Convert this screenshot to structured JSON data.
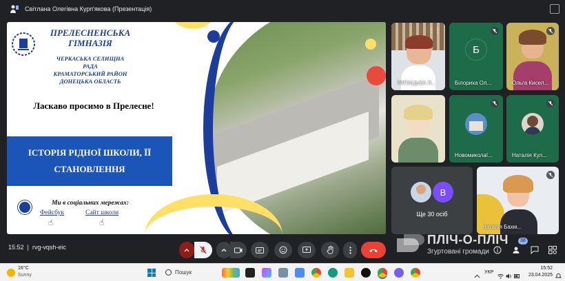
{
  "topbar": {
    "presenter_title": "Світлана Олегівна Курп'якова (Презентація)"
  },
  "slide": {
    "school_title": "ПРЕЛЕСНЕНСЬКА ГІМНАЗІЯ",
    "school_sub_1": "ЧЕРКАСЬКА СЕЛИЩНА",
    "school_sub_2": "РАДА",
    "school_sub_3": "КРАМАТОРСЬКИЙ РАЙОН",
    "school_sub_4": "ДОНЕЦЬКА ОБЛАСТЬ",
    "welcome": "Ласкаво просимо в Прелесне!",
    "history_1": "ІСТОРІЯ РІДНОЇ ШКОЛИ, ЇЇ",
    "history_2": "СТАНОВЛЕННЯ",
    "social_title": "Ми в соціальних мережах:",
    "link_facebook": "Фейсбук",
    "link_site": "Сайт школи"
  },
  "participants": [
    {
      "name": "РАПАЦЬКА Л...",
      "muted": false
    },
    {
      "name": "Білориха Ол...",
      "initial": "Б",
      "muted": true
    },
    {
      "name": "Ольга Кисел...",
      "muted": true
    },
    {
      "name": "",
      "muted": false
    },
    {
      "name": "Новомиколаї...",
      "muted": true
    },
    {
      "name": "Наталія Кул...",
      "muted": true
    },
    {
      "name": "Ще 30 осіб",
      "initial": "В"
    },
    {
      "name": "Наталія Бахм...",
      "muted": true
    }
  ],
  "meetbar": {
    "time": "15:52",
    "meeting_code": "rvg-vqsh-eic",
    "participants_badge": "38"
  },
  "watermark": {
    "line1": "ПЛІЧ-О-ПЛІЧ",
    "line2": "Згуртовані громади"
  },
  "taskbar": {
    "temperature": "16°C",
    "condition": "Sunny",
    "search_label": "Пошук",
    "language": "УКР",
    "time": "15:52",
    "date": "23.04.2025"
  },
  "colors": {
    "slide_blue": "#1c3d9c",
    "box_blue": "#1c55b8",
    "accent_yellow": "#ffe066",
    "end_call_red": "#ea4335",
    "tile_green": "#1e6b4a"
  }
}
